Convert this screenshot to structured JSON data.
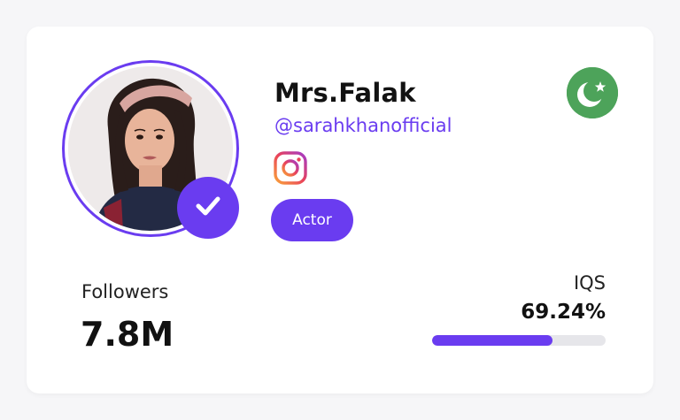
{
  "profile": {
    "name": "Mrs.Falak",
    "handle": "@sarahkhanofficial",
    "platform_icon": "instagram-icon",
    "category": "Actor",
    "country_flag_icon": "pakistan-flag-icon",
    "verified_icon": "check-icon"
  },
  "stats": {
    "followers_label": "Followers",
    "followers_value": "7.8M",
    "iqs_label": "IQS",
    "iqs_value": "69.24%",
    "iqs_fraction": 0.6924
  },
  "colors": {
    "accent": "#6a3cf0",
    "flag_green": "#4da35a",
    "track": "#e6e6ea"
  }
}
